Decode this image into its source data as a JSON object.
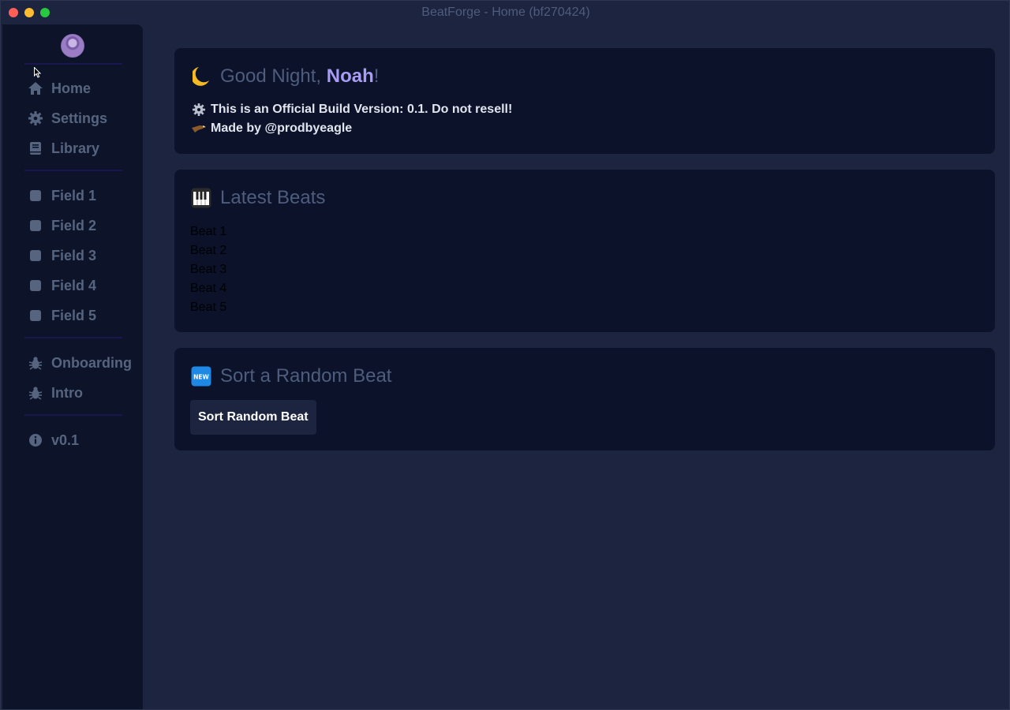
{
  "window": {
    "title": "BeatForge - Home (bf270424)"
  },
  "sidebar": {
    "main_items": [
      {
        "label": "Home",
        "icon": "home-icon"
      },
      {
        "label": "Settings",
        "icon": "gear-icon"
      },
      {
        "label": "Library",
        "icon": "book-icon"
      }
    ],
    "fields": [
      {
        "label": "Field 1",
        "icon": "square-icon"
      },
      {
        "label": "Field 2",
        "icon": "square-icon"
      },
      {
        "label": "Field 3",
        "icon": "square-icon"
      },
      {
        "label": "Field 4",
        "icon": "square-icon"
      },
      {
        "label": "Field 5",
        "icon": "square-icon"
      }
    ],
    "debug_items": [
      {
        "label": "Onboarding",
        "icon": "bug-icon"
      },
      {
        "label": "Intro",
        "icon": "bug-icon"
      }
    ],
    "version": {
      "label": "v0.1",
      "icon": "info-icon"
    }
  },
  "greeting": {
    "prefix": "Good Night, ",
    "name": "Noah",
    "suffix": "!",
    "icon": "crescent-moon-icon",
    "build_notice": "This is an Official Build Version: 0.1. Do not resell!",
    "made_by": "Made by @prodbyeagle"
  },
  "latest_beats": {
    "title": "Latest Beats",
    "icon": "piano-icon",
    "items": [
      "Beat 1",
      "Beat 2",
      "Beat 3",
      "Beat 4",
      "Beat 5"
    ]
  },
  "random_beat": {
    "title": "Sort a Random Beat",
    "icon": "new-badge-icon",
    "button_label": "Sort Random Beat"
  },
  "colors": {
    "background": "#1c2440",
    "sidebar": "#0d1429",
    "card": "#0b1229",
    "muted_text": "#56647f",
    "accent": "#a99cf5"
  }
}
